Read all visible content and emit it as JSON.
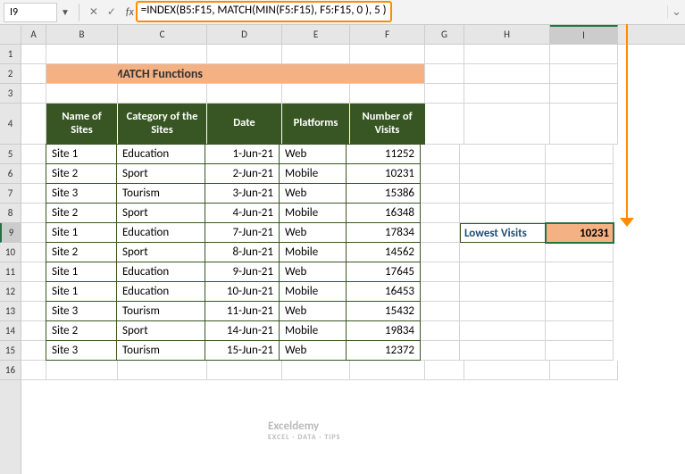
{
  "nameBox": "I9",
  "formulaBar": "=INDEX(B5:F15, MATCH(MIN(F5:F15), F5:F15, 0 ), 5 )",
  "columns": [
    "A",
    "B",
    "C",
    "D",
    "E",
    "F",
    "G",
    "H",
    "I"
  ],
  "title": "Using INDEX MATCH Functions",
  "headers": {
    "b": "Name of Sites",
    "c": "Category of the Sites",
    "d": "Date",
    "e": "Platforms",
    "f": "Number of Visits"
  },
  "rows": [
    {
      "site": "Site 1",
      "cat": "Education",
      "date": "1-Jun-21",
      "plat": "Web",
      "visits": "11252"
    },
    {
      "site": "Site 2",
      "cat": "Sport",
      "date": "2-Jun-21",
      "plat": "Mobile",
      "visits": "10231"
    },
    {
      "site": "Site 3",
      "cat": "Tourism",
      "date": "3-Jun-21",
      "plat": "Web",
      "visits": "15386"
    },
    {
      "site": "Site 2",
      "cat": "Sport",
      "date": "4-Jun-21",
      "plat": "Mobile",
      "visits": "16348"
    },
    {
      "site": "Site 1",
      "cat": "Education",
      "date": "7-Jun-21",
      "plat": "Web",
      "visits": "17834"
    },
    {
      "site": "Site 2",
      "cat": "Sport",
      "date": "8-Jun-21",
      "plat": "Mobile",
      "visits": "14562"
    },
    {
      "site": "Site 1",
      "cat": "Education",
      "date": "9-Jun-21",
      "plat": "Web",
      "visits": "17645"
    },
    {
      "site": "Site 1",
      "cat": "Education",
      "date": "10-Jun-21",
      "plat": "Mobile",
      "visits": "16453"
    },
    {
      "site": "Site 3",
      "cat": "Tourism",
      "date": "11-Jun-21",
      "plat": "Web",
      "visits": "15432"
    },
    {
      "site": "Site 2",
      "cat": "Sport",
      "date": "14-Jun-21",
      "plat": "Mobile",
      "visits": "19834"
    },
    {
      "site": "Site 3",
      "cat": "Tourism",
      "date": "15-Jun-21",
      "plat": "Web",
      "visits": "12372"
    }
  ],
  "result": {
    "label": "Lowest Visits",
    "value": "10231"
  },
  "watermark": {
    "brand": "Exceldemy",
    "tag": "EXCEL · DATA · TIPS"
  }
}
